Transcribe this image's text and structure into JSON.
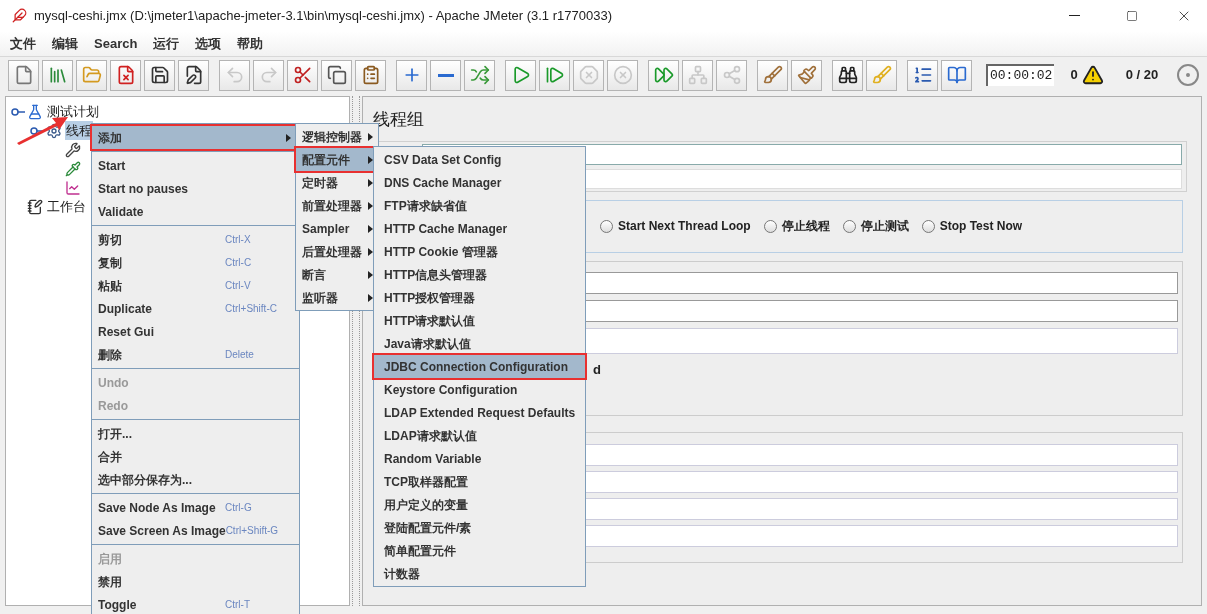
{
  "window": {
    "title": "mysql-ceshi.jmx (D:\\jmeter1\\apache-jmeter-3.1\\bin\\mysql-ceshi.jmx) - Apache JMeter (3.1 r1770033)"
  },
  "menu_bar": [
    "文件",
    "编辑",
    "Search",
    "运行",
    "选项",
    "帮助"
  ],
  "toolbar": {
    "groups": [
      [
        {
          "kind": "new",
          "disabled": false
        },
        {
          "kind": "templates",
          "disabled": false
        },
        {
          "kind": "open",
          "disabled": false
        },
        {
          "kind": "close",
          "disabled": false
        },
        {
          "kind": "save",
          "disabled": false
        },
        {
          "kind": "save_as",
          "disabled": false
        }
      ],
      [
        {
          "kind": "undo",
          "disabled": true
        },
        {
          "kind": "redo",
          "disabled": true
        },
        {
          "kind": "cut",
          "disabled": false
        },
        {
          "kind": "copy",
          "disabled": false
        },
        {
          "kind": "paste",
          "disabled": false
        }
      ],
      [
        {
          "kind": "expand",
          "disabled": false
        },
        {
          "kind": "collapse",
          "disabled": false
        },
        {
          "kind": "toggle",
          "disabled": false
        }
      ],
      [
        {
          "kind": "start",
          "disabled": false
        },
        {
          "kind": "start_no_pauses",
          "disabled": false
        },
        {
          "kind": "stop",
          "disabled": true
        },
        {
          "kind": "shutdown",
          "disabled": true
        }
      ],
      [
        {
          "kind": "remote_start",
          "disabled": false
        },
        {
          "kind": "remote_stop",
          "disabled": true
        },
        {
          "kind": "remote_shutdown",
          "disabled": true
        }
      ],
      [
        {
          "kind": "clear",
          "disabled": false
        },
        {
          "kind": "clear_all",
          "disabled": false
        }
      ],
      [
        {
          "kind": "search",
          "disabled": false
        },
        {
          "kind": "reset_search",
          "disabled": false
        }
      ],
      [
        {
          "kind": "function_helper",
          "disabled": false
        },
        {
          "kind": "help",
          "disabled": false
        }
      ]
    ],
    "timer": "00:00:02",
    "warnings": "0",
    "threads": "0 / 20"
  },
  "tree": [
    {
      "kind": "test_plan",
      "label": "测试计划",
      "expanded": true,
      "children": [
        {
          "kind": "thread_group",
          "label": "线程",
          "selected": true,
          "expanded": true,
          "children": [
            {
              "kind": "config"
            },
            {
              "kind": "sampler"
            },
            {
              "kind": "listener"
            }
          ]
        }
      ]
    },
    {
      "kind": "workbench",
      "label": "工作台"
    }
  ],
  "panel": {
    "title": "线程组",
    "fragment": "d",
    "error_actions": [
      {
        "label": "Start Next Thread Loop",
        "selected": false
      },
      {
        "label": "停止线程",
        "selected": false
      },
      {
        "label": "停止测试",
        "selected": false
      },
      {
        "label": "Stop Test Now",
        "selected": false
      }
    ]
  },
  "context_menu": [
    [
      {
        "label": "添加",
        "submenu": true,
        "disabled": false,
        "selected": true
      }
    ],
    [
      {
        "label": "Start",
        "submenu": false,
        "disabled": false,
        "selected": false
      },
      {
        "label": "Start no pauses",
        "submenu": false,
        "disabled": false,
        "selected": false
      },
      {
        "label": "Validate",
        "submenu": false,
        "disabled": false,
        "selected": false
      }
    ],
    [
      {
        "label": "剪切",
        "shortcut": "Ctrl-X",
        "submenu": false,
        "disabled": false,
        "selected": false
      },
      {
        "label": "复制",
        "shortcut": "Ctrl-C",
        "submenu": false,
        "disabled": false,
        "selected": false
      },
      {
        "label": "粘贴",
        "shortcut": "Ctrl-V",
        "submenu": false,
        "disabled": false,
        "selected": false
      },
      {
        "label": "Duplicate",
        "shortcut": "Ctrl+Shift-C",
        "submenu": false,
        "disabled": false,
        "selected": false
      },
      {
        "label": "Reset Gui",
        "submenu": false,
        "disabled": false,
        "selected": false
      },
      {
        "label": "删除",
        "shortcut": "Delete",
        "submenu": false,
        "disabled": false,
        "selected": false
      }
    ],
    [
      {
        "label": "Undo",
        "submenu": false,
        "disabled": true,
        "selected": false
      },
      {
        "label": "Redo",
        "submenu": false,
        "disabled": true,
        "selected": false
      }
    ],
    [
      {
        "label": "打开...",
        "submenu": false,
        "disabled": false,
        "selected": false
      },
      {
        "label": "合并",
        "submenu": false,
        "disabled": false,
        "selected": false
      },
      {
        "label": "选中部分保存为...",
        "submenu": false,
        "disabled": false,
        "selected": false
      }
    ],
    [
      {
        "label": "Save Node As Image",
        "shortcut": "Ctrl-G",
        "submenu": false,
        "disabled": false,
        "selected": false
      },
      {
        "label": "Save Screen As Image",
        "shortcut": "Ctrl+Shift-G",
        "submenu": false,
        "disabled": false,
        "selected": false
      }
    ],
    [
      {
        "label": "启用",
        "submenu": false,
        "disabled": true,
        "selected": false
      },
      {
        "label": "禁用",
        "submenu": false,
        "disabled": false,
        "selected": false
      },
      {
        "label": "Toggle",
        "shortcut": "Ctrl-T",
        "submenu": false,
        "disabled": false,
        "selected": false
      }
    ]
  ],
  "add_submenu": [
    {
      "label": "逻辑控制器",
      "selected": false
    },
    {
      "label": "配置元件",
      "selected": true
    },
    {
      "label": "定时器",
      "selected": false
    },
    {
      "label": "前置处理器",
      "selected": false
    },
    {
      "label": "Sampler",
      "selected": false
    },
    {
      "label": "后置处理器",
      "selected": false
    },
    {
      "label": "断言",
      "selected": false
    },
    {
      "label": "监听器",
      "selected": false
    }
  ],
  "config_submenu": [
    {
      "label": "CSV Data Set Config",
      "selected": false
    },
    {
      "label": "DNS Cache Manager",
      "selected": false
    },
    {
      "label": "FTP请求缺省值",
      "selected": false
    },
    {
      "label": "HTTP Cache Manager",
      "selected": false
    },
    {
      "label": "HTTP Cookie 管理器",
      "selected": false
    },
    {
      "label": "HTTP信息头管理器",
      "selected": false
    },
    {
      "label": "HTTP授权管理器",
      "selected": false
    },
    {
      "label": "HTTP请求默认值",
      "selected": false
    },
    {
      "label": "Java请求默认值",
      "selected": false
    },
    {
      "label": "JDBC Connection Configuration",
      "selected": true
    },
    {
      "label": "Keystore Configuration",
      "selected": false
    },
    {
      "label": "LDAP Extended Request Defaults",
      "selected": false
    },
    {
      "label": "LDAP请求默认值",
      "selected": false
    },
    {
      "label": "Random Variable",
      "selected": false
    },
    {
      "label": "TCP取样器配置",
      "selected": false
    },
    {
      "label": "用户定义的变量",
      "selected": false
    },
    {
      "label": "登陆配置元件/素",
      "selected": false
    },
    {
      "label": "简单配置元件",
      "selected": false
    },
    {
      "label": "计数器",
      "selected": false
    }
  ]
}
